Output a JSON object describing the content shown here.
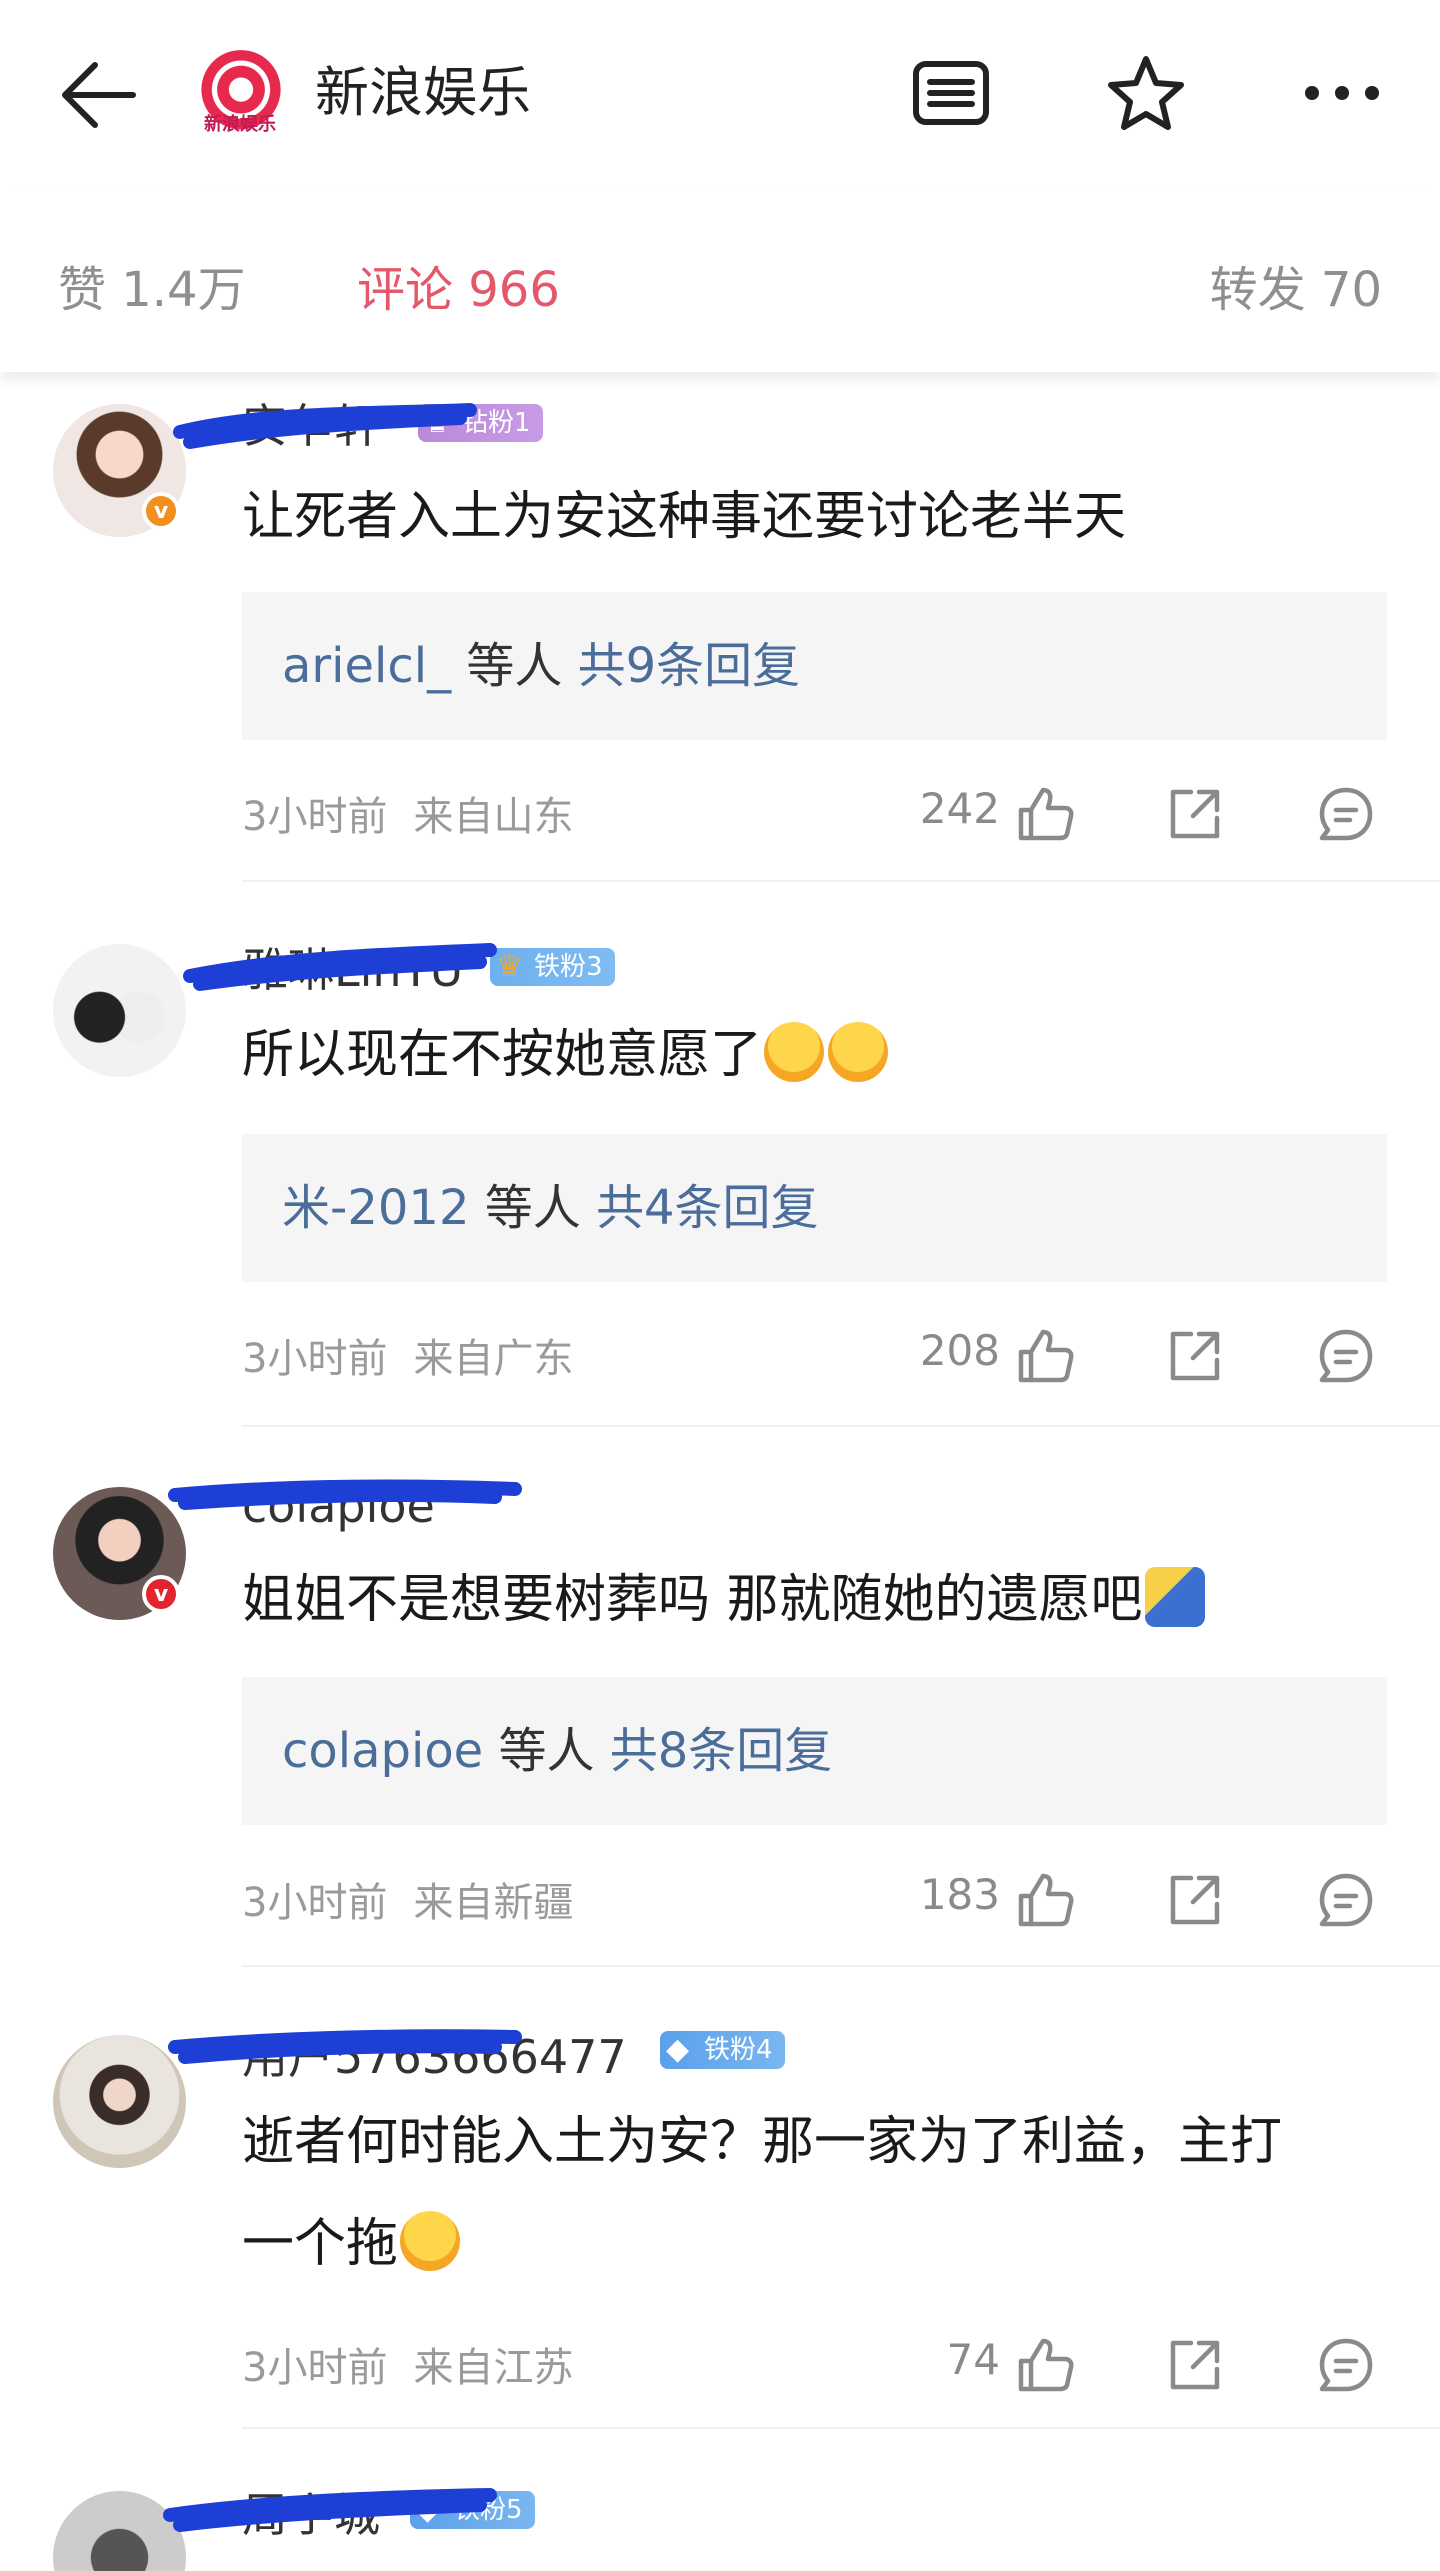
{
  "header": {
    "title": "新浪娱乐",
    "logo_text": "新浪娱乐"
  },
  "tabs": {
    "like": "赞 1.4万",
    "comment": "评论 966",
    "forward": "转发 70"
  },
  "comments": [
    {
      "username": "安乍轩",
      "badge": "钻粉1",
      "text": "让死者入土为安这种事还要讨论老半天",
      "reply_name": "arielcl_",
      "reply_mid": " 等人 ",
      "reply_count": "共9条回复",
      "time": "3小时前",
      "location": "来自山东",
      "likes": "242"
    },
    {
      "username": "雅琳LinTU",
      "badge": "铁粉3",
      "text": "所以现在不按她意愿了",
      "reply_name": "米-2012",
      "reply_mid": " 等人 ",
      "reply_count": "共4条回复",
      "time": "3小时前",
      "location": "来自广东",
      "likes": "208"
    },
    {
      "username": "colapioe",
      "text": "姐姐不是想要树葬吗 那就随她的遗愿吧",
      "reply_name": "colapioe",
      "reply_mid": " 等人 ",
      "reply_count": "共8条回复",
      "time": "3小时前",
      "location": "来自新疆",
      "likes": "183"
    },
    {
      "username": "用户5763666477",
      "badge": "铁粉4",
      "text_line1": "逝者何时能入土为安？那一家为了利益，主打",
      "text_line2": "一个拖",
      "time": "3小时前",
      "location": "来自江苏",
      "likes": "74"
    },
    {
      "username": "周宇城",
      "badge": "铁粉5"
    }
  ],
  "colors": {
    "accent": "#e4586a",
    "link": "#4a6d9a",
    "meta": "#9a9a9a",
    "reply_bg": "#f5f5f5"
  },
  "icons": [
    "back-arrow-icon",
    "sina-logo-icon",
    "article-icon",
    "star-icon",
    "more-icon",
    "thumb-up-icon",
    "share-icon",
    "reply-icon"
  ]
}
